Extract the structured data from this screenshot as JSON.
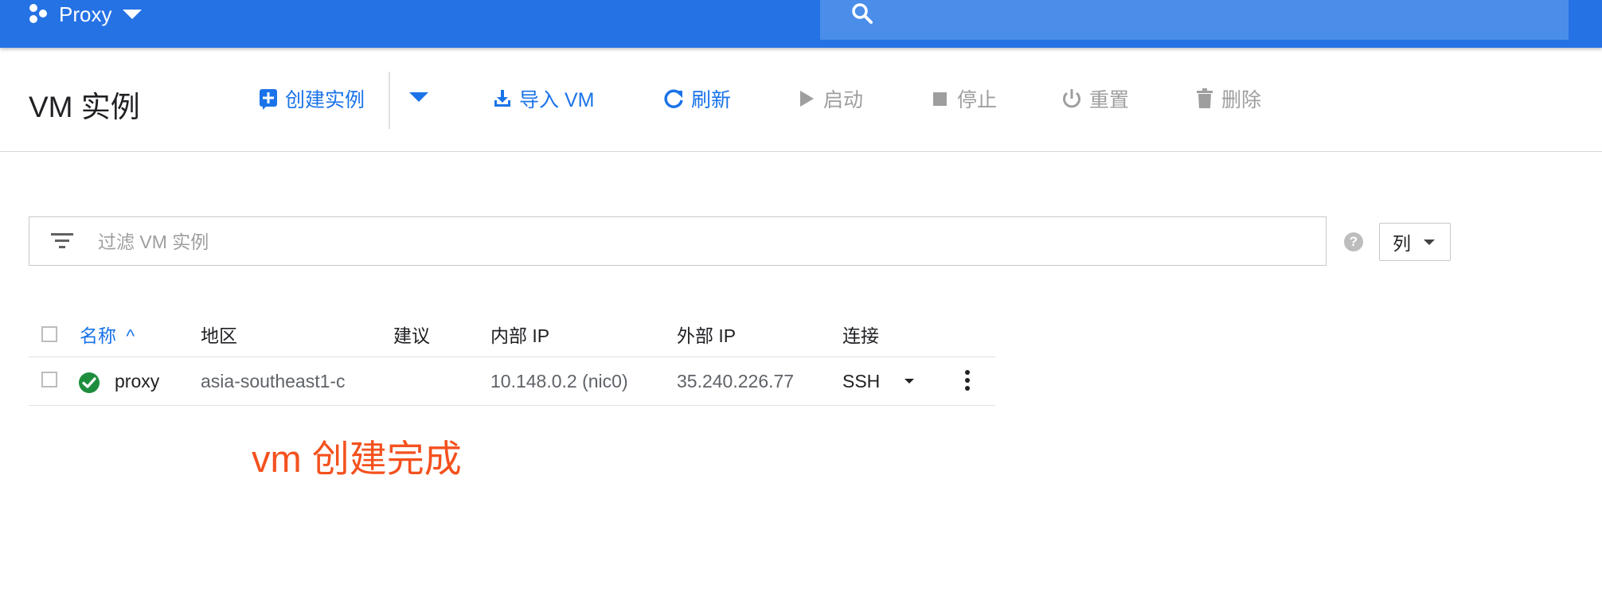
{
  "topbar": {
    "project_name": "Proxy",
    "project_icon": "project-dots-icon",
    "search_icon": "search-icon"
  },
  "actionbar": {
    "title": "VM 实例",
    "actions": {
      "create": "创建实例",
      "import": "导入 VM",
      "refresh": "刷新",
      "start": "启动",
      "stop": "停止",
      "reset": "重置",
      "delete": "删除"
    }
  },
  "filter": {
    "placeholder": "过滤 VM 实例",
    "columns_button": "列",
    "help_icon": "?"
  },
  "table": {
    "headers": {
      "name": "名称",
      "zone": "地区",
      "recommendation": "建议",
      "internal_ip": "内部 IP",
      "external_ip": "外部 IP",
      "connect": "连接"
    },
    "sort_indicator": "^",
    "rows": [
      {
        "status": "running",
        "name": "proxy",
        "zone": "asia-southeast1-c",
        "recommendation": "",
        "internal_ip": "10.148.0.2 (nic0)",
        "external_ip": "35.240.226.77",
        "connect": "SSH"
      }
    ]
  },
  "annotation": "vm 创建完成",
  "colors": {
    "topbar": "#2572e4",
    "search": "#4a8eea",
    "accent": "#1a73e8",
    "disabled": "#9e9e9e",
    "success": "#1e8e3e",
    "annotation": "#f4511e"
  }
}
